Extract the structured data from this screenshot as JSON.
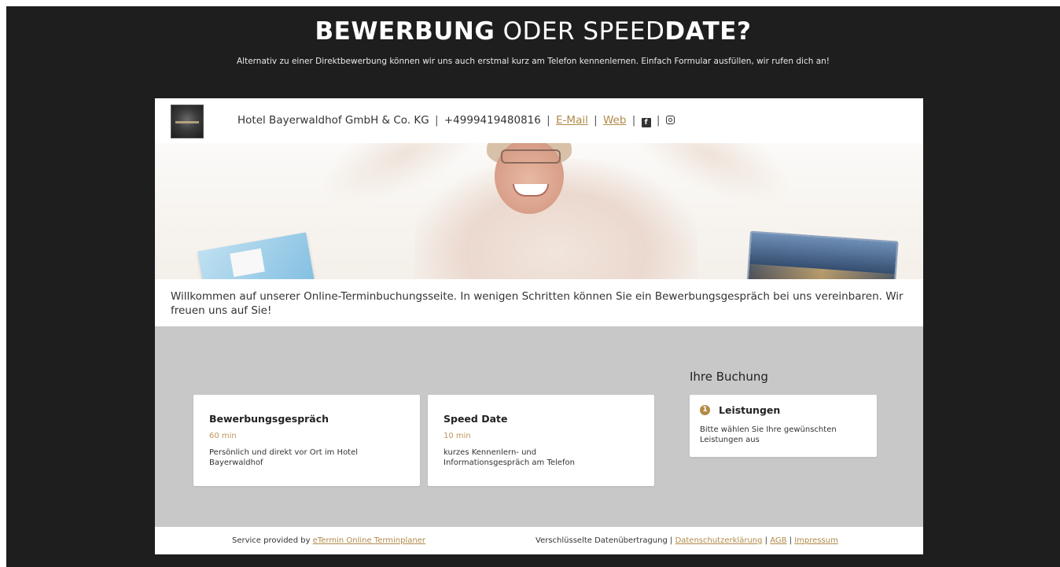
{
  "header": {
    "title_bold_1": "BEWERBUNG",
    "title_light": " ODER SPEED",
    "title_bold_2": "DATE?",
    "subtitle": "Alternativ zu einer Direktbewerbung können wir uns auch erstmal kurz am Telefon kennenlernen. Einfach Formular ausfüllen, wir rufen dich an!"
  },
  "company": {
    "name": "Hotel Bayerwaldhof GmbH & Co. KG",
    "phone": "+4999419480816",
    "email_label": "E-Mail",
    "web_label": "Web",
    "separator": "|",
    "facebook_glyph": "f"
  },
  "welcome_text": "Willkommen auf unserer Online-Terminbuchungsseite. In wenigen Schritten können Sie ein Bewerbungsgespräch bei uns vereinbaren. Wir freuen uns auf Sie!",
  "services": [
    {
      "title": "Bewerbungsgespräch",
      "duration": "60 min",
      "description": "Persönlich und direkt vor Ort im Hotel Bayerwaldhof"
    },
    {
      "title": "Speed Date",
      "duration": "10 min",
      "description": "kurzes Kennenlern- und Informationsgespräch am Telefon"
    }
  ],
  "booking": {
    "title": "Ihre Buchung",
    "step_number": "1",
    "step_label": "Leistungen",
    "step_description": "Bitte wählen Sie Ihre gewünschten Leistungen aus"
  },
  "footer": {
    "provided_prefix": "Service provided by ",
    "provider_link": "eTermin Online Terminplaner",
    "secure_text": "Verschlüsselte Datenübertragung",
    "privacy_link": "Datenschutzerklärung",
    "agb_link": "AGB",
    "imprint_link": "Impressum",
    "separator": "|"
  },
  "colors": {
    "page_bg": "#1e1e1e",
    "accent": "#b08a4a",
    "panel_bg": "#c8c8c8"
  }
}
